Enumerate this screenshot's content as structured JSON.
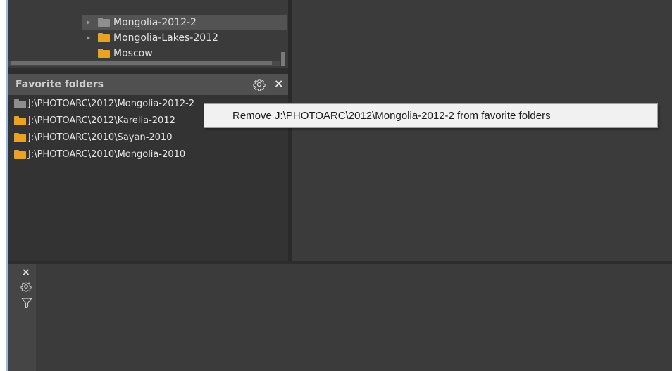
{
  "tree": {
    "items": [
      {
        "label": "Mongolia-2012-2",
        "expandable": true,
        "selected": true,
        "folder_color": "grey"
      },
      {
        "label": "Mongolia-Lakes-2012",
        "expandable": true,
        "selected": false,
        "folder_color": "orange"
      },
      {
        "label": "Moscow",
        "expandable": false,
        "selected": false,
        "folder_color": "orange"
      }
    ]
  },
  "favorites": {
    "title": "Favorite folders",
    "settings_icon": "gear-icon",
    "close_label": "×",
    "items": [
      {
        "path": "J:\\PHOTOARC\\2012\\Mongolia-2012-2",
        "folder_color": "grey"
      },
      {
        "path": "J:\\PHOTOARC\\2012\\Karelia-2012",
        "folder_color": "orange"
      },
      {
        "path": "J:\\PHOTOARC\\2010\\Sayan-2010",
        "folder_color": "orange"
      },
      {
        "path": "J:\\PHOTOARC\\2010\\Mongolia-2010",
        "folder_color": "orange"
      }
    ]
  },
  "tooltip": {
    "text": "Remove J:\\PHOTOARC\\2012\\Mongolia-2012-2 from favorite folders"
  },
  "bottom_toolbar": {
    "close_label": "×",
    "icons": [
      "close-icon",
      "gear-icon",
      "filter-icon"
    ]
  },
  "colors": {
    "panel_bg": "#333333",
    "header_bg": "#505050",
    "folder_orange": "#e9a321",
    "folder_grey": "#8e8e8e",
    "accent_strip": "#9ab9e3"
  }
}
